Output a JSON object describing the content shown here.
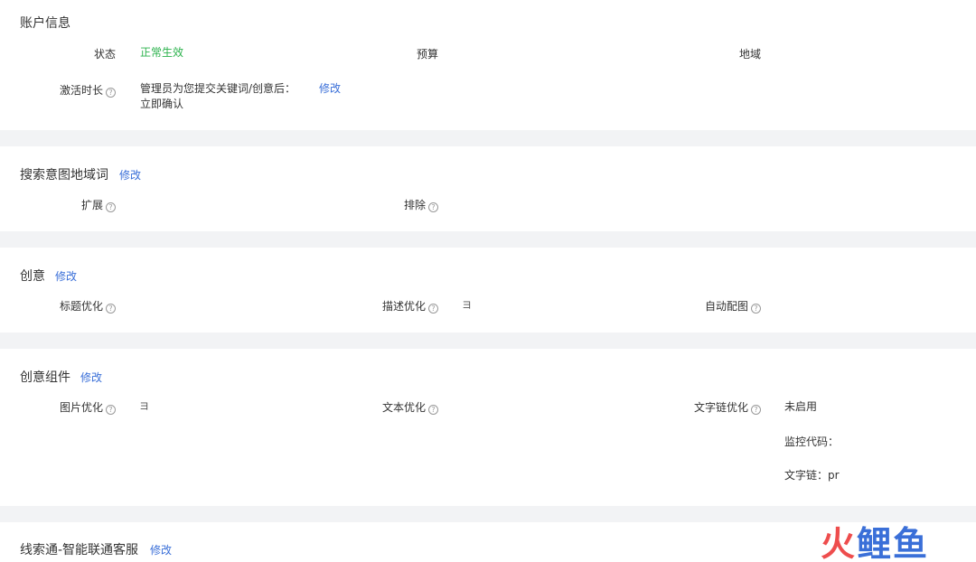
{
  "account": {
    "title": "账户信息",
    "status_label": "状态",
    "status_value": "正常生效",
    "budget_label": "预算",
    "region_label": "地域",
    "activation_label": "激活时长",
    "activation_line1": "管理员为您提交关键词/创意后：",
    "activation_line2": "立即确认",
    "edit": "修改"
  },
  "search_intent": {
    "title": "搜索意图地域词",
    "edit": "修改",
    "expand_label": "扩展",
    "exclude_label": "排除"
  },
  "creative": {
    "title": "创意",
    "edit": "修改",
    "title_opt_label": "标题优化",
    "desc_opt_label": "描述优化",
    "desc_opt_value": "ヨ",
    "auto_img_label": "自动配图"
  },
  "components": {
    "title": "创意组件",
    "edit": "修改",
    "img_opt_label": "图片优化",
    "img_opt_value": "ヨ",
    "text_opt_label": "文本优化",
    "textlink_opt_label": "文字链优化",
    "textlink_status": "未启用",
    "monitor_code": "监控代码：",
    "textlink_value": "文字链：pr"
  },
  "clue": {
    "title": "线索通-智能联通客服",
    "edit": "修改"
  },
  "watermark": {
    "text1": "火",
    "text2": "鲤鱼"
  },
  "help_glyph": "?"
}
